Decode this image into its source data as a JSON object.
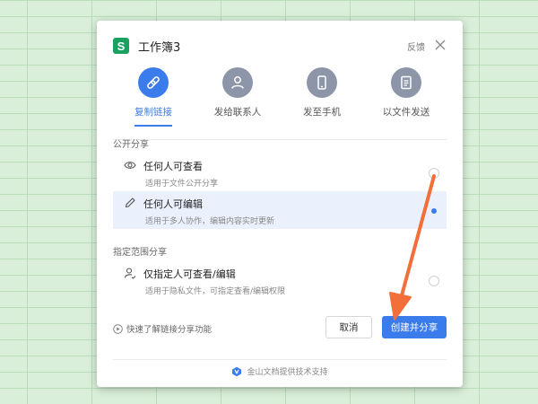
{
  "dialog": {
    "app_logo": "S",
    "title": "工作簿3",
    "feedback": "反馈"
  },
  "tabs": [
    {
      "label": "复制链接",
      "icon": "link-icon",
      "active": true
    },
    {
      "label": "发给联系人",
      "icon": "contact-icon",
      "active": false
    },
    {
      "label": "发至手机",
      "icon": "phone-icon",
      "active": false
    },
    {
      "label": "以文件发送",
      "icon": "file-icon",
      "active": false
    }
  ],
  "sections": {
    "public": "公开分享",
    "restricted": "指定范围分享"
  },
  "options": [
    {
      "title": "任何人可查看",
      "desc": "适用于文件公开分享",
      "icon": "eye-icon",
      "selected": false
    },
    {
      "title": "任何人可编辑",
      "desc": "适用于多人协作，编辑内容实时更新",
      "icon": "pencil-icon",
      "selected": true
    },
    {
      "title": "仅指定人可查看/编辑",
      "desc": "适用于隐私文件，可指定查看/编辑权限",
      "icon": "person-lock-icon",
      "selected": false
    }
  ],
  "help_link": "快速了解链接分享功能",
  "buttons": {
    "cancel": "取消",
    "create": "创建并分享"
  },
  "footer": "金山文档提供技术支持",
  "colors": {
    "accent": "#3b7ced",
    "logo": "#1aa05f",
    "annotation_arrow": "#f26f3a"
  }
}
